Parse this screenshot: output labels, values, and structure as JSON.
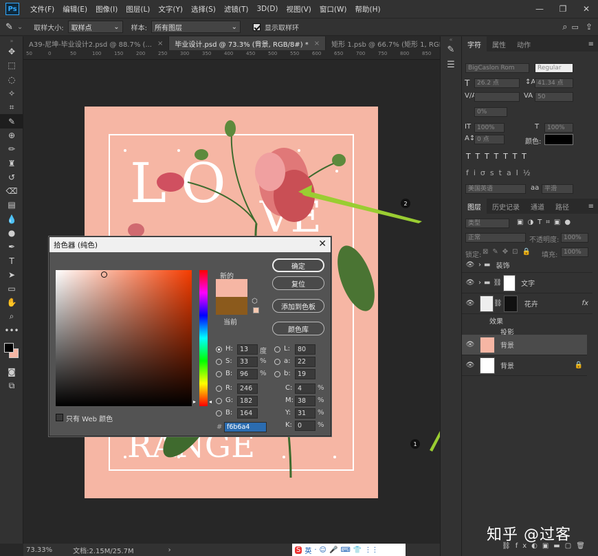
{
  "menu": {
    "logo": "Ps",
    "items": [
      "文件(F)",
      "编辑(E)",
      "图像(I)",
      "图层(L)",
      "文字(Y)",
      "选择(S)",
      "滤镜(T)",
      "3D(D)",
      "视图(V)",
      "窗口(W)",
      "帮助(H)"
    ],
    "window_controls": [
      "—",
      "❐",
      "✕"
    ]
  },
  "options": {
    "sample_size_label": "取样大小:",
    "sample_size_value": "取样点",
    "sample_label": "样本:",
    "sample_value": "所有图层",
    "show_ring_label": "显示取样环"
  },
  "tabs": [
    {
      "label": "A39-尼坤-毕业设计2.psd @ 88.7% (..."
    },
    {
      "label": "毕业设计.psd @ 73.3% (背景, RGB/8#) *"
    },
    {
      "label": "矩形 1.psb @ 66.7% (矩形 1, RGB/8..."
    }
  ],
  "ruler": [
    "50",
    "0",
    "50",
    "100",
    "150",
    "200",
    "250",
    "300",
    "350",
    "400",
    "450",
    "500",
    "550",
    "600",
    "650",
    "700",
    "750",
    "800",
    "850"
  ],
  "artwork": {
    "letters_top": [
      "L",
      "O"
    ],
    "letters_mid": "VE",
    "letters_bottom": "RANGE",
    "bg_color": "#f6b6a4"
  },
  "status": {
    "zoom": "73.33%",
    "doc": "文档:2.15M/25.7M"
  },
  "char_panel": {
    "tabs": [
      "字符",
      "属性",
      "动作"
    ],
    "font_family": "BigCaslon Rom",
    "font_style": "Regular",
    "size": "26.2 点",
    "leading": "41.34 点",
    "tracking": "50",
    "scale_pct": "0%",
    "v_scale": "100%",
    "h_scale": "100%",
    "baseline": "0 点",
    "color_label": "颜色:",
    "language": "美国英语",
    "aa_label": "aa",
    "aa_value": "平滑"
  },
  "layers_panel": {
    "tabs": [
      "图层",
      "历史记录",
      "通道",
      "路径"
    ],
    "filter": "类型",
    "blend_mode": "正常",
    "opacity_label": "不透明度:",
    "opacity": "100%",
    "lock_label": "锁定:",
    "fill_label": "填充:",
    "fill": "100%",
    "layers": [
      {
        "name": "装饰",
        "type": "group"
      },
      {
        "name": "文字",
        "type": "group-masked"
      },
      {
        "name": "花卉",
        "type": "smart",
        "fx": "fx"
      },
      {
        "name": "背景",
        "type": "color",
        "selected": true
      },
      {
        "name": "背景",
        "type": "base",
        "locked": true
      }
    ],
    "effects_label": "效果",
    "effect_item": "投影"
  },
  "picker": {
    "title": "拾色器 (纯色)",
    "new_label": "新的",
    "current_label": "当前",
    "new_color": "#f6b6a4",
    "current_color": "#8b5a1c",
    "buttons": [
      "确定",
      "复位",
      "添加到色板",
      "颜色库"
    ],
    "hsb": {
      "H": "13",
      "S": "33",
      "B": "96"
    },
    "hsb_units": {
      "H": "度",
      "S": "%",
      "B": "%"
    },
    "lab": {
      "L": "80",
      "a": "22",
      "b": "19"
    },
    "rgb": {
      "R": "246",
      "G": "182",
      "B": "164"
    },
    "cmyk": {
      "C": "4",
      "M": "38",
      "Y": "31",
      "K": "0"
    },
    "hex": "f6b6a4",
    "web_only_label": "只有 Web 颜色"
  },
  "annotations": [
    "1",
    "2"
  ],
  "watermark": "知乎 @过客",
  "taskbar": [
    "S",
    "英",
    "·",
    "☺",
    "🎤",
    "⌨",
    "👕",
    "⋮⋮"
  ]
}
